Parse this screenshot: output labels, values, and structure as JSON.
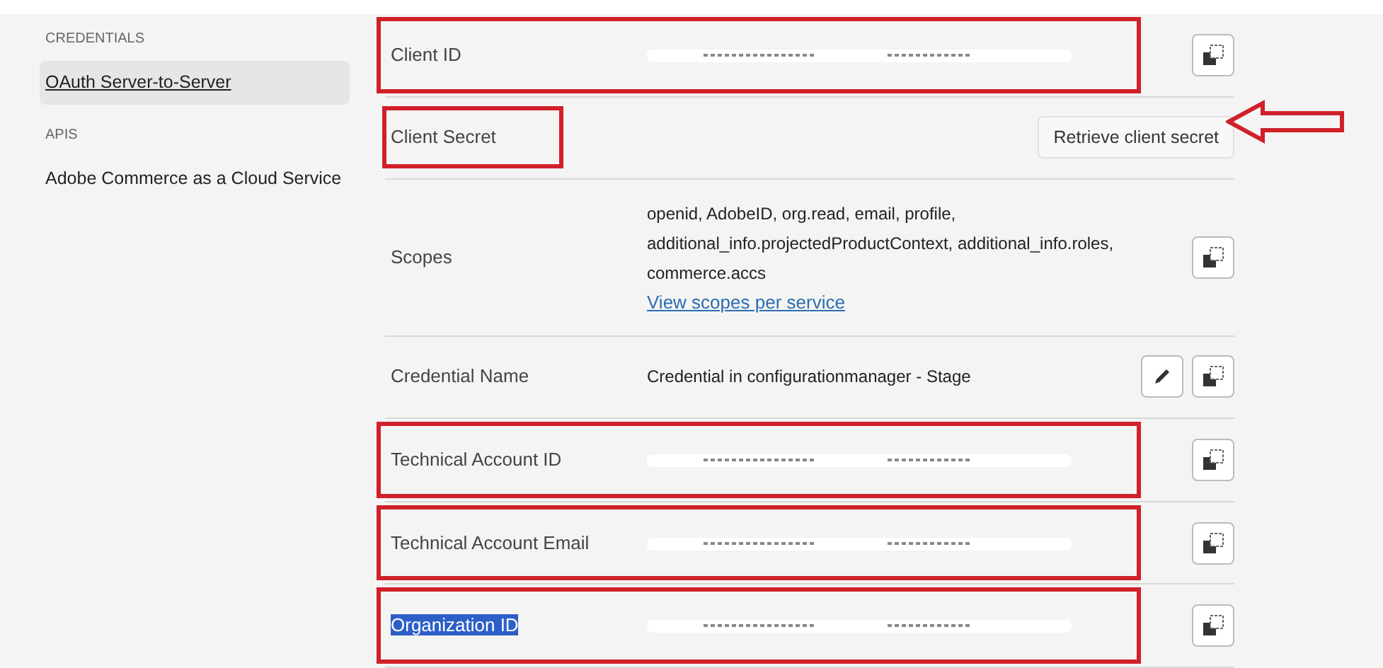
{
  "sidebar": {
    "sections": [
      {
        "heading": "CREDENTIALS",
        "items": [
          {
            "label": "OAuth Server-to-Server",
            "selected": true
          }
        ]
      },
      {
        "heading": "APIS",
        "items": [
          {
            "label": "Adobe Commerce as a Cloud Service",
            "selected": false
          }
        ]
      }
    ]
  },
  "rows": [
    {
      "label": "Client ID",
      "kind": "redacted",
      "row_boxed": true,
      "label_boxed": false,
      "arrow": false,
      "copy": true,
      "edit": false,
      "label_selected": false
    },
    {
      "label": "Client Secret",
      "kind": "button",
      "button": "Retrieve client secret",
      "row_boxed": false,
      "label_boxed": true,
      "arrow": true,
      "copy": false,
      "edit": false,
      "label_selected": false
    },
    {
      "label": "Scopes",
      "kind": "text",
      "value": "openid, AdobeID, org.read, email, profile, additional_info.projectedProductContext, additional_info.roles, commerce.accs",
      "link": "View scopes per service",
      "row_boxed": false,
      "label_boxed": false,
      "arrow": false,
      "copy": true,
      "edit": false,
      "label_selected": false
    },
    {
      "label": "Credential Name",
      "kind": "text",
      "value": "Credential in configurationmanager - Stage",
      "row_boxed": false,
      "label_boxed": false,
      "arrow": false,
      "copy": true,
      "edit": true,
      "label_selected": false
    },
    {
      "label": "Technical Account ID",
      "kind": "redacted",
      "row_boxed": true,
      "label_boxed": false,
      "arrow": false,
      "copy": true,
      "edit": false,
      "label_selected": false
    },
    {
      "label": "Technical Account Email",
      "kind": "redacted",
      "row_boxed": true,
      "label_boxed": false,
      "arrow": false,
      "copy": true,
      "edit": false,
      "label_selected": false
    },
    {
      "label": "Organization ID",
      "kind": "redacted",
      "row_boxed": true,
      "label_boxed": false,
      "arrow": false,
      "copy": true,
      "edit": false,
      "label_selected": true
    }
  ]
}
